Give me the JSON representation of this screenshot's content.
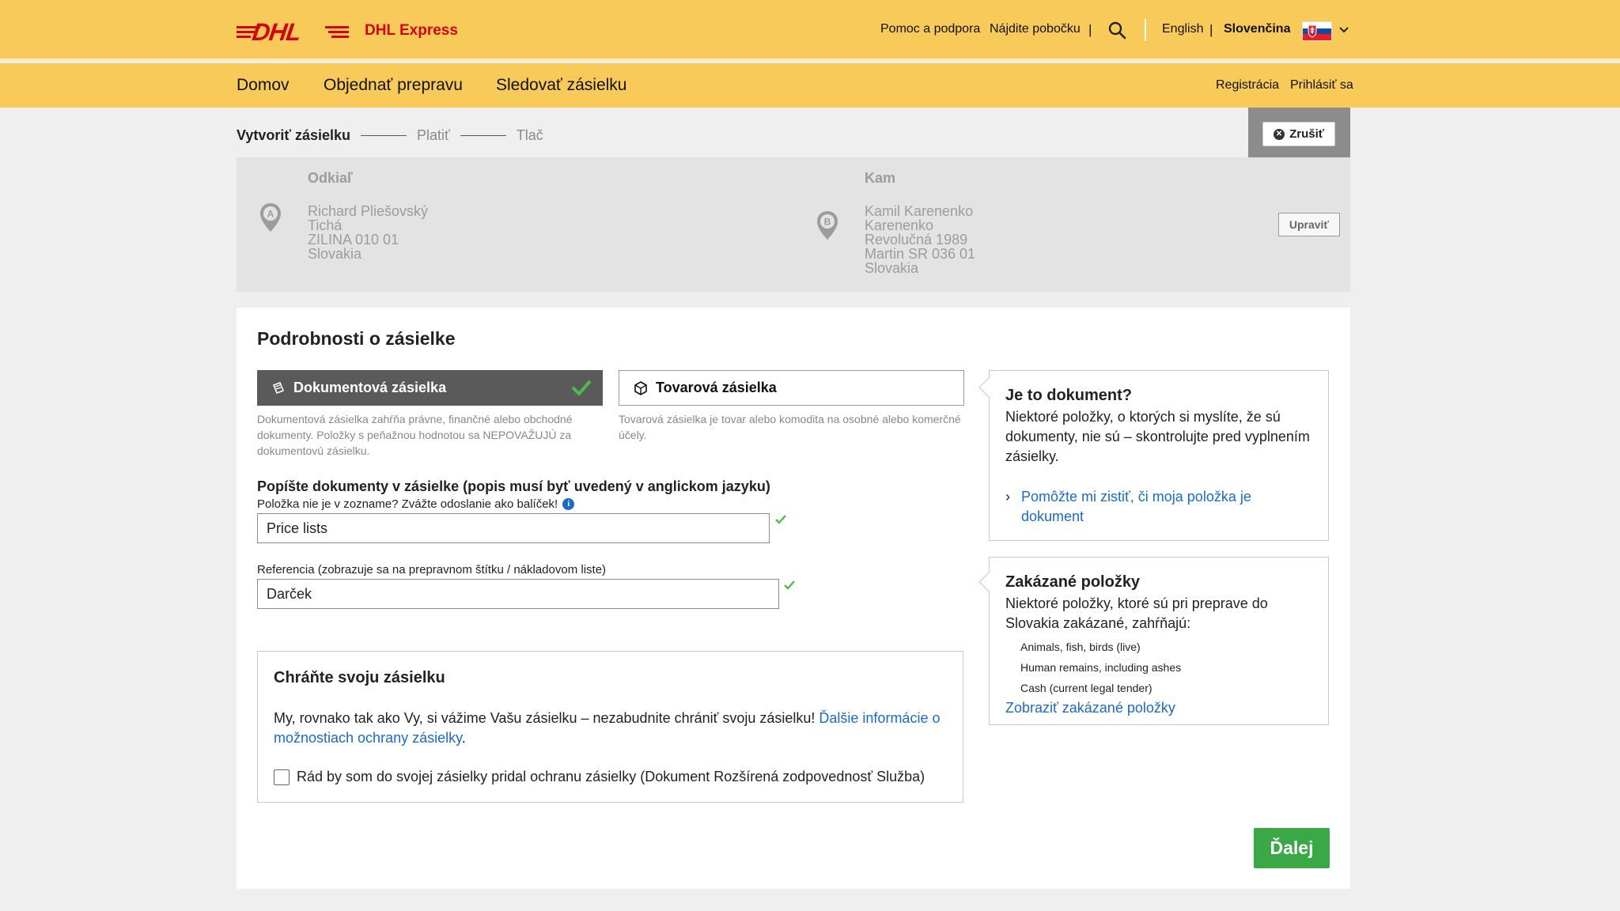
{
  "header": {
    "brand": "DHL",
    "product": "DHL Express",
    "links": [
      "Pomoc a podpora",
      "Nájdite pobočku"
    ],
    "languages": [
      "English",
      "Slovenčina"
    ],
    "active_language": "Slovenčina",
    "flag_colors": [
      "#ffffff",
      "#0b4ea2",
      "#ee1c25"
    ]
  },
  "nav": {
    "items": [
      "Domov",
      "Objednať prepravu",
      "Sledovať zásielku"
    ],
    "right": [
      "Registrácia",
      "Prihlásiť sa"
    ]
  },
  "steps": [
    "Vytvoriť zásielku",
    "Platiť",
    "Tlač"
  ],
  "cancel_label": "Zrušiť",
  "from": {
    "heading": "Odkiaľ",
    "marker": "A",
    "lines": [
      "Richard Pliešovský",
      "Tichá",
      "ZILINA 010 01",
      "Slovakia"
    ]
  },
  "to": {
    "heading": "Kam",
    "marker": "B",
    "lines": [
      "Kamil Karenenko",
      "Karenenko",
      "Revolučná 1989",
      "Martin SR 036 01",
      "Slovakia"
    ]
  },
  "edit_label": "Upraviť",
  "details": {
    "title": "Podrobnosti o zásielke",
    "doc_option": "Dokumentová zásielka",
    "doc_help": "Dokumentová zásielka zahŕňa právne, finančné alebo obchodné dokumenty. Položky s peňažnou hodnotou sa NEPOVAŽUJÚ za dokumentovú zásielku.",
    "goods_option": "Tovarová zásielka",
    "goods_help": "Tovarová zásielka je tovar alebo komodita na osobné alebo komerčné účely.",
    "describe_label": "Popíšte dokumenty v zásielke (popis musí byť uvedený v anglickom jazyku)",
    "describe_sub": "Položka nie je v zozname? Zvážte odoslanie ako balíček!",
    "describe_value": "Price lists",
    "ref_label": "Referencia (zobrazuje sa na prepravnom štítku / nákladovom liste)",
    "ref_value": "Darček"
  },
  "protect": {
    "title": "Chráňte svoju zásielku",
    "text": "My, rovnako tak ako Vy, si vážime Vašu zásielku – nezabudnite chrániť svoju zásielku! ",
    "link": "Ďalšie informácie o možnostiach ochrany zásielky",
    "period": ".",
    "checkbox_label": "Rád by som do svojej zásielky pridal ochranu zásielky (Dokument Rozšírená zodpovednosť Služba)",
    "checked": false
  },
  "doc_info": {
    "title": "Je to dokument?",
    "text": "Niektoré položky, o ktorých si myslíte, že sú dokumenty, nie sú – skontrolujte pred vyplnením zásielky.",
    "link": "Pomôžte mi zistiť, či moja položka je dokument"
  },
  "prohibited": {
    "title": "Zakázané položky",
    "text": "Niektoré položky, ktoré sú pri preprave do Slovakia zakázané, zahŕňajú:",
    "items": [
      "Animals, fish, birds (live)",
      "Human remains, including ashes",
      "Cash (current legal tender)"
    ],
    "link": "Zobraziť zakázané položky"
  },
  "next_label": "Ďalej",
  "colors": {
    "dhl_yellow": "#f7ca5a",
    "dhl_red": "#d40511",
    "selected_dark": "#5a5a5a",
    "link_blue": "#1a6bc4",
    "next_green": "#3aa845"
  }
}
